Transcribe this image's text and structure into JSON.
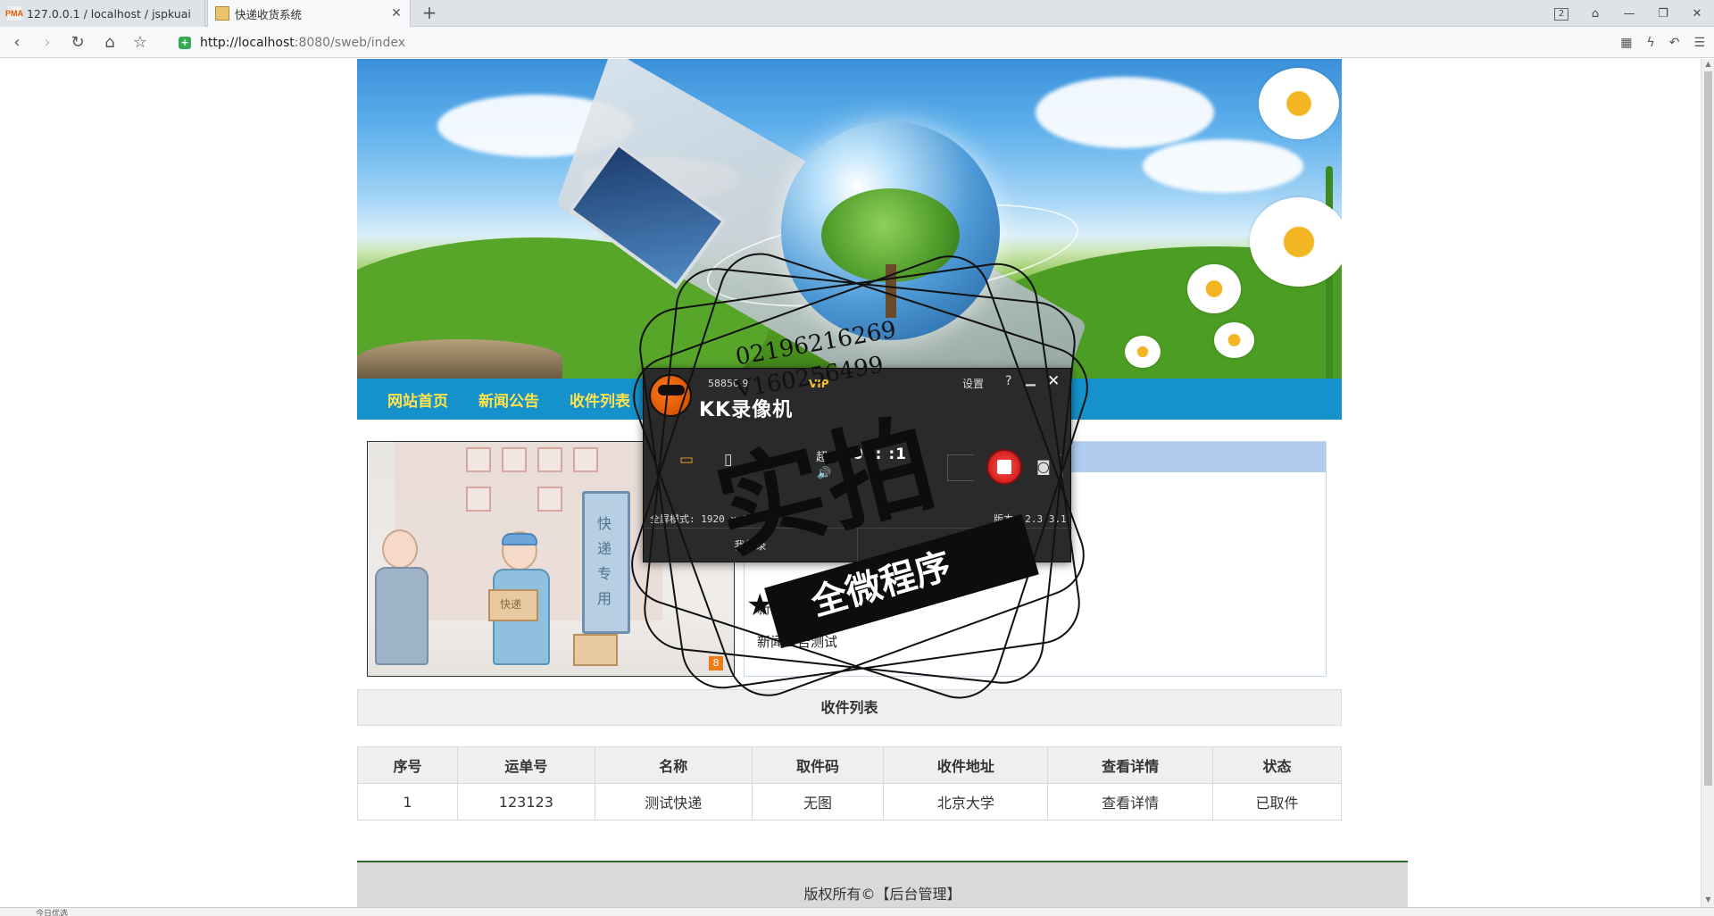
{
  "browser": {
    "tabs": [
      {
        "label": "127.0.0.1 / localhost / jspkuai",
        "favicon": "PMA",
        "active": false
      },
      {
        "label": "快递收货系统",
        "active": true
      }
    ],
    "new_tab_label": "+",
    "window_badge": "2",
    "url_host": "http://localhost",
    "url_rest": ":8080/sweb/index"
  },
  "site": {
    "nav": [
      "网站首页",
      "新闻公告",
      "收件列表"
    ],
    "news_items": [
      "新闻公告测试",
      "新闻公告测试"
    ],
    "illustration": {
      "sign_text": "快递专用",
      "box_label": "快递",
      "page_num": "8"
    },
    "list_title": "收件列表",
    "table": {
      "headers": [
        "序号",
        "运单号",
        "名称",
        "取件码",
        "收件地址",
        "查看详情",
        "状态"
      ],
      "rows": [
        [
          "1",
          "123123",
          "测试快递",
          "无图",
          "北京大学",
          "查看详情",
          "已取件"
        ]
      ]
    },
    "footer": {
      "copyright": "版权所有©",
      "admin_link": "【后台管理】"
    }
  },
  "kk_recorder": {
    "brand": "KK录像机",
    "account": "58850 9",
    "vip": "VIP",
    "settings": "设置",
    "help": "?",
    "super_label": "超",
    "timer": "00: :1",
    "mode": "全屏模式: 1920 x 1",
    "version": "版本: 2.3.3.1",
    "my_recordings": "我的录"
  },
  "watermark": {
    "phone1": "02196216269",
    "phone2": "V160256499",
    "big_text": "实拍",
    "ribbon_text": "全微程序"
  },
  "status": {
    "left": "今日优选"
  },
  "colors": {
    "menu_bg": "#1592cb",
    "menu_text": "#ffe34d",
    "news_header": "#b0cdf0",
    "footer_border": "#2f6b2e",
    "rec_red": "#d61f1f"
  }
}
